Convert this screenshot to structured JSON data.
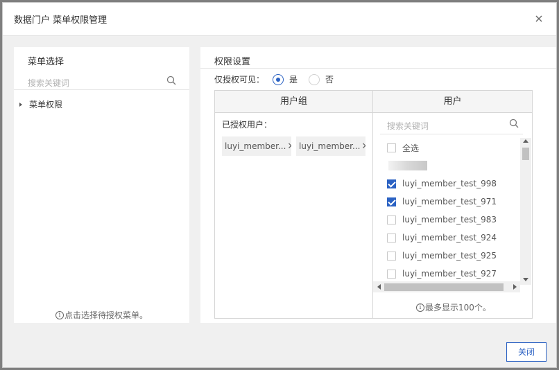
{
  "dialog": {
    "title": "数据门户 菜单权限管理",
    "close_icon": "close-icon",
    "close_button_label": "关闭"
  },
  "left_panel": {
    "title": "菜单选择",
    "search_placeholder": "搜索关键词",
    "tree": [
      {
        "label": "菜单权限",
        "expanded": false
      }
    ],
    "hint": "点击选择待授权菜单。"
  },
  "right_panel": {
    "title": "权限设置",
    "visibility_label": "仅授权可见：",
    "visibility_options": [
      {
        "label": "是",
        "selected": true
      },
      {
        "label": "否",
        "selected": false
      }
    ],
    "group_column": {
      "header": "用户组",
      "authorized_label": "已授权用户：",
      "chips": [
        "luyi_member...",
        "luyi_member..."
      ]
    },
    "user_column": {
      "header": "用户",
      "search_placeholder": "搜索关键词",
      "select_all_label": "全选",
      "users": [
        {
          "name": "luyi_member_test_998",
          "checked": true
        },
        {
          "name": "luyi_member_test_971",
          "checked": true
        },
        {
          "name": "luyi_member_test_983",
          "checked": false
        },
        {
          "name": "luyi_member_test_924",
          "checked": false
        },
        {
          "name": "luyi_member_test_925",
          "checked": false
        },
        {
          "name": "luyi_member_test_927",
          "checked": false
        }
      ],
      "hint": "最多显示100个。"
    }
  },
  "colors": {
    "accent": "#2b62c3",
    "overlay": "#7f7f7f"
  }
}
